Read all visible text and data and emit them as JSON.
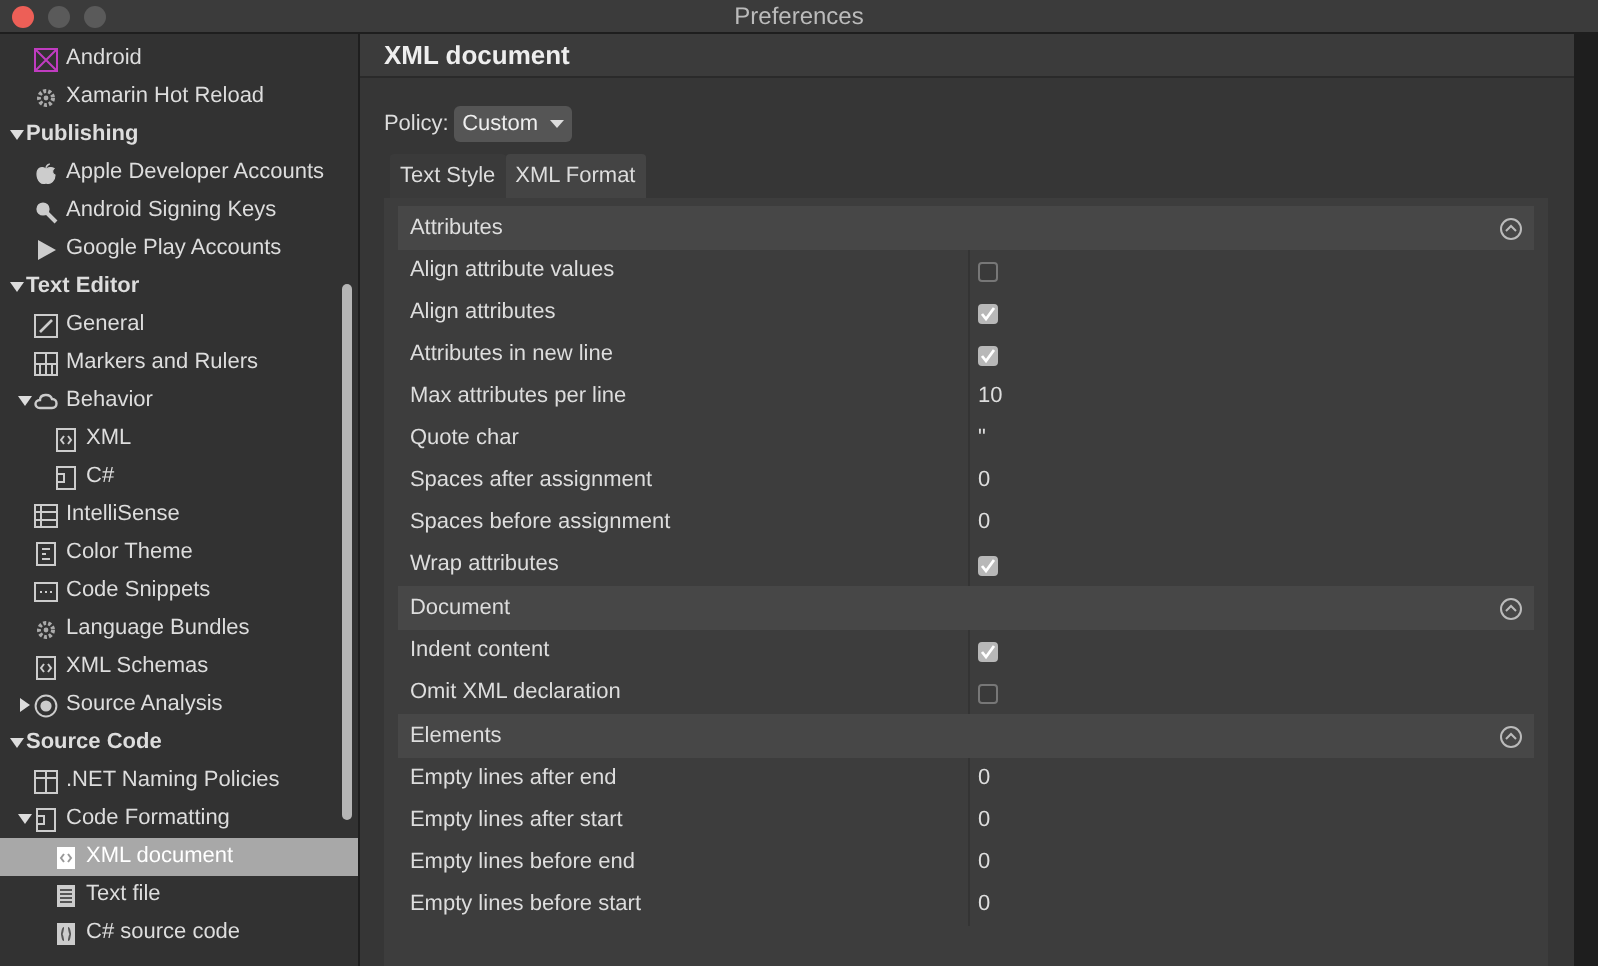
{
  "window": {
    "title": "Preferences"
  },
  "sidebar": {
    "items": [
      {
        "kind": "cut-group",
        "children": [
          {
            "label": "Android",
            "selected": false
          },
          {
            "label": "Xamarin Hot Reload",
            "selected": false
          }
        ]
      },
      {
        "kind": "category",
        "label": "Publishing",
        "expanded": true,
        "selected": false,
        "children": [
          {
            "label": "Apple Developer Accounts",
            "selected": false
          },
          {
            "label": "Android Signing Keys",
            "selected": false
          },
          {
            "label": "Google Play Accounts",
            "selected": false
          }
        ]
      },
      {
        "kind": "category",
        "label": "Text Editor",
        "expanded": true,
        "selected": false,
        "children": [
          {
            "label": "General",
            "selected": false
          },
          {
            "label": "Markers and Rulers",
            "selected": false
          },
          {
            "label": "Behavior",
            "expanded": true,
            "selected": false,
            "children": [
              {
                "label": "XML",
                "selected": false
              },
              {
                "label": "C#",
                "selected": false
              }
            ]
          },
          {
            "label": "IntelliSense",
            "selected": false
          },
          {
            "label": "Color Theme",
            "selected": false
          },
          {
            "label": "Code Snippets",
            "selected": false
          },
          {
            "label": "Language Bundles",
            "selected": false
          },
          {
            "label": "XML Schemas",
            "selected": false
          },
          {
            "label": "Source Analysis",
            "expanded": false,
            "selected": false
          }
        ]
      },
      {
        "kind": "category",
        "label": "Source Code",
        "expanded": true,
        "selected": false,
        "children": [
          {
            "label": ".NET Naming Policies",
            "selected": false
          },
          {
            "label": "Code Formatting",
            "expanded": true,
            "selected": false,
            "children": [
              {
                "label": "XML document",
                "selected": true
              },
              {
                "label": "Text file",
                "selected": false
              },
              {
                "label": "C# source code",
                "selected": false
              }
            ]
          }
        ]
      }
    ]
  },
  "main": {
    "title": "XML document",
    "policy": {
      "label": "Policy:",
      "value": "Custom"
    },
    "tabs": [
      {
        "label": "Text Style",
        "selected": false
      },
      {
        "label": "XML Format",
        "selected": true
      }
    ],
    "sections": [
      {
        "title": "Attributes",
        "expanded": true,
        "rows": [
          {
            "label": "Align attribute values",
            "kind": "checkbox",
            "checked": false
          },
          {
            "label": "Align attributes",
            "kind": "checkbox",
            "checked": true
          },
          {
            "label": "Attributes in new line",
            "kind": "checkbox",
            "checked": true
          },
          {
            "label": "Max attributes per line",
            "kind": "text",
            "value": "10"
          },
          {
            "label": "Quote char",
            "kind": "text",
            "value": "\""
          },
          {
            "label": "Spaces after assignment",
            "kind": "text",
            "value": "0"
          },
          {
            "label": "Spaces before assignment",
            "kind": "text",
            "value": "0"
          },
          {
            "label": "Wrap attributes",
            "kind": "checkbox",
            "checked": true
          }
        ]
      },
      {
        "title": "Document",
        "expanded": true,
        "rows": [
          {
            "label": "Indent content",
            "kind": "checkbox",
            "checked": true
          },
          {
            "label": "Omit XML declaration",
            "kind": "checkbox",
            "checked": false
          }
        ]
      },
      {
        "title": "Elements",
        "expanded": true,
        "rows": [
          {
            "label": "Empty lines after end",
            "kind": "text",
            "value": "0"
          },
          {
            "label": "Empty lines after start",
            "kind": "text",
            "value": "0"
          },
          {
            "label": "Empty lines before end",
            "kind": "text",
            "value": "0"
          },
          {
            "label": "Empty lines before start",
            "kind": "text",
            "value": "0"
          }
        ]
      }
    ]
  }
}
